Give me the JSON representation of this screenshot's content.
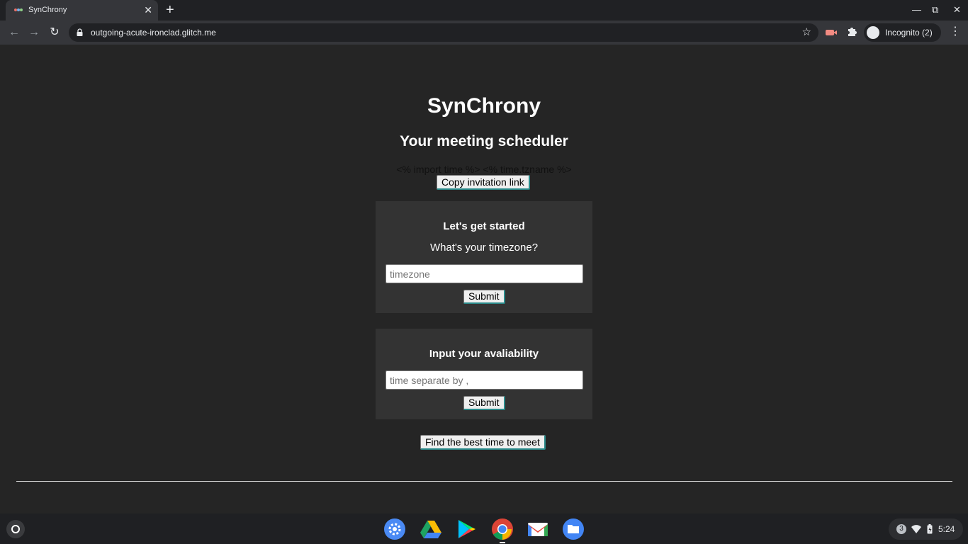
{
  "browser": {
    "tab_title": "SynChrony",
    "tab_close": "✕",
    "new_tab": "+",
    "url": "outgoing-acute-ironclad.glitch.me",
    "profile_label": "Incognito (2)",
    "window_controls": {
      "minimize": "—",
      "restore": "⧉",
      "close": "✕"
    }
  },
  "page": {
    "title": "SynChrony",
    "subtitle": "Your meeting scheduler",
    "template_text": "<% import time %> <% time.tzname %>",
    "copy_link_label": "Copy invitation link",
    "timezone_card": {
      "heading": "Let's get started",
      "question": "What's your timezone?",
      "placeholder": "timezone",
      "submit_label": "Submit"
    },
    "availability_card": {
      "heading": "Input your avaliability",
      "placeholder": "time separate by ,",
      "submit_label": "Submit"
    },
    "find_best_label": "Find the best time to meet"
  },
  "shelf": {
    "apps": [
      "settings-icon",
      "google-drive-icon",
      "google-play-icon",
      "chrome-icon",
      "gmail-icon",
      "files-icon"
    ],
    "notification_count": "3",
    "time": "5:24"
  },
  "colors": {
    "page_bg": "#252525",
    "card_bg": "#333333",
    "accent_border": "#2a8a8a"
  }
}
